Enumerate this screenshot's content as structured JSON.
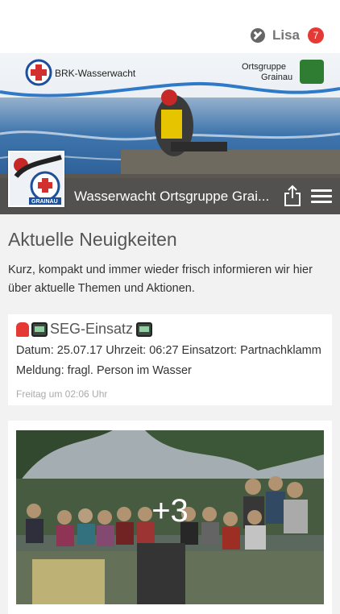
{
  "header": {
    "user_name": "Lisa",
    "notification_count": "7",
    "logo_icon": "app-logo-icon"
  },
  "cover": {
    "left_logo_text": "BRK-Wasserwacht",
    "right_logo_line1": "Ortsgruppe",
    "right_logo_line2": "Grainau",
    "profile_label": "GRAINAU",
    "page_title": "Wasserwacht Ortsgruppe Grai..."
  },
  "section": {
    "title": "Aktuelle Neuigkeiten",
    "description": "Kurz, kompakt und immer wieder frisch informieren wir hier über aktuelle Themen und Aktionen."
  },
  "post": {
    "title": "SEG-Einsatz",
    "line1": "Datum: 25.07.17 Uhrzeit: 06:27 Einsatzort: Partnachklamm",
    "line2": "Meldung: fragl. Person im Wasser",
    "time": "Freitag um 02:06 Uhr"
  },
  "photo_post": {
    "more_count": "+3"
  },
  "colors": {
    "badge": "#e53935",
    "page_bar": "#505050",
    "water": "#2f6fb0"
  }
}
